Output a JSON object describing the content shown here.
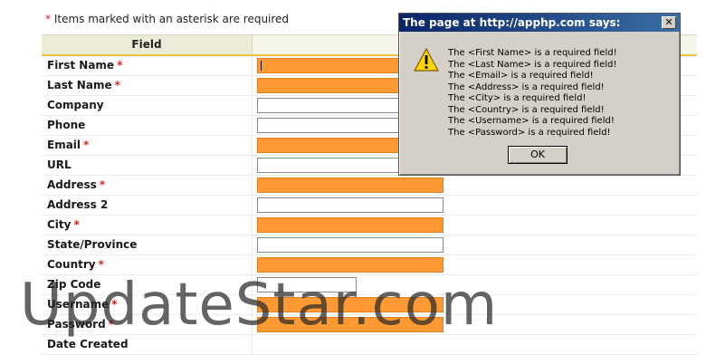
{
  "note": {
    "asterisk": "*",
    "text": "Items marked with an asterisk are required"
  },
  "table": {
    "header_field": "Field",
    "rows": [
      {
        "label": "First Name",
        "required": true,
        "field": "required",
        "focused": true
      },
      {
        "label": "Last Name",
        "required": true,
        "field": "required"
      },
      {
        "label": "Company",
        "required": false,
        "field": "normal"
      },
      {
        "label": "Phone",
        "required": false,
        "field": "normal"
      },
      {
        "label": "Email",
        "required": true,
        "field": "required"
      },
      {
        "label": "URL",
        "required": false,
        "field": "normal"
      },
      {
        "label": "Address",
        "required": true,
        "field": "required"
      },
      {
        "label": "Address 2",
        "required": false,
        "field": "normal"
      },
      {
        "label": "City",
        "required": true,
        "field": "required"
      },
      {
        "label": "State/Province",
        "required": false,
        "field": "normal"
      },
      {
        "label": "Country",
        "required": true,
        "field": "required"
      },
      {
        "label": "Zip Code",
        "required": false,
        "field": "short"
      },
      {
        "label": "Username",
        "required": true,
        "field": "required"
      },
      {
        "label": "Password",
        "required": true,
        "field": "required"
      },
      {
        "label": "Date Created",
        "required": false,
        "field": "none"
      }
    ],
    "required_marker": "*"
  },
  "dialog": {
    "title": "The page at http://apphp.com says:",
    "close_label": "✕",
    "messages": [
      "The <First Name> is a required field!",
      "The <Last Name> is a required field!",
      "The <Email> is a required field!",
      "The <Address> is a required field!",
      "The <City> is a required field!",
      "The <Country> is a required field!",
      "The <Username> is a required field!",
      "The <Password> is a required field!"
    ],
    "ok_label": "OK"
  },
  "watermark": "UpdateStar.com",
  "colors": {
    "required_fill": "#ff9933",
    "asterisk": "#e02020",
    "header_bg": "#ebebd8",
    "titlebar_start": "#0a246a",
    "titlebar_end": "#3a6ea5"
  }
}
